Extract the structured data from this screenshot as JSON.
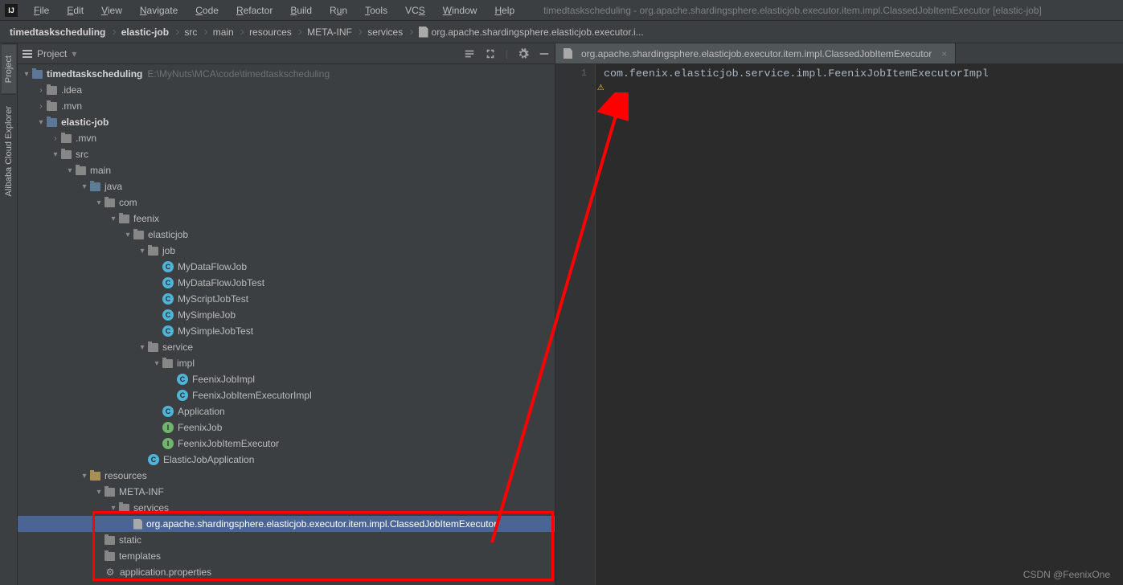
{
  "window_title": "timedtaskscheduling - org.apache.shardingsphere.elasticjob.executor.item.impl.ClassedJobItemExecutor [elastic-job]",
  "menu": [
    "File",
    "Edit",
    "View",
    "Navigate",
    "Code",
    "Refactor",
    "Build",
    "Run",
    "Tools",
    "VCS",
    "Window",
    "Help"
  ],
  "breadcrumb": [
    "timedtaskscheduling",
    "elastic-job",
    "src",
    "main",
    "resources",
    "META-INF",
    "services",
    "org.apache.shardingsphere.elasticjob.executor.i..."
  ],
  "side_tabs": [
    "Project",
    "Alibaba Cloud Explorer"
  ],
  "project_header": {
    "title": "Project"
  },
  "tree": {
    "root": {
      "label": "timedtaskscheduling",
      "extra": "E:\\MyNuts\\MCA\\code\\timedtaskscheduling"
    },
    "items": {
      "idea": ".idea",
      "mvn_root": ".mvn",
      "elastic_job": "elastic-job",
      "mvn": ".mvn",
      "src": "src",
      "main": "main",
      "java": "java",
      "com": "com",
      "feenix": "feenix",
      "elasticjob": "elasticjob",
      "job": "job",
      "MyDataFlowJob": "MyDataFlowJob",
      "MyDataFlowJobTest": "MyDataFlowJobTest",
      "MyScriptJobTest": "MyScriptJobTest",
      "MySimpleJob": "MySimpleJob",
      "MySimpleJobTest": "MySimpleJobTest",
      "service": "service",
      "impl": "impl",
      "FeenixJobImpl": "FeenixJobImpl",
      "FeenixJobItemExecutorImpl": "FeenixJobItemExecutorImpl",
      "Application": "Application",
      "FeenixJob": "FeenixJob",
      "FeenixJobItemExecutor": "FeenixJobItemExecutor",
      "ElasticJobApplication": "ElasticJobApplication",
      "resources": "resources",
      "META-INF": "META-INF",
      "services": "services",
      "spi_file": "org.apache.shardingsphere.elasticjob.executor.item.impl.ClassedJobItemExecutor",
      "static": "static",
      "templates": "templates",
      "app_props": "application.properties"
    }
  },
  "editor": {
    "tab_name": "org.apache.shardingsphere.elasticjob.executor.item.impl.ClassedJobItemExecutor",
    "line_number": "1",
    "content": "com.feenix.elasticjob.service.impl.FeenixJobItemExecutorImpl"
  },
  "watermark": "CSDN @FeenixOne"
}
